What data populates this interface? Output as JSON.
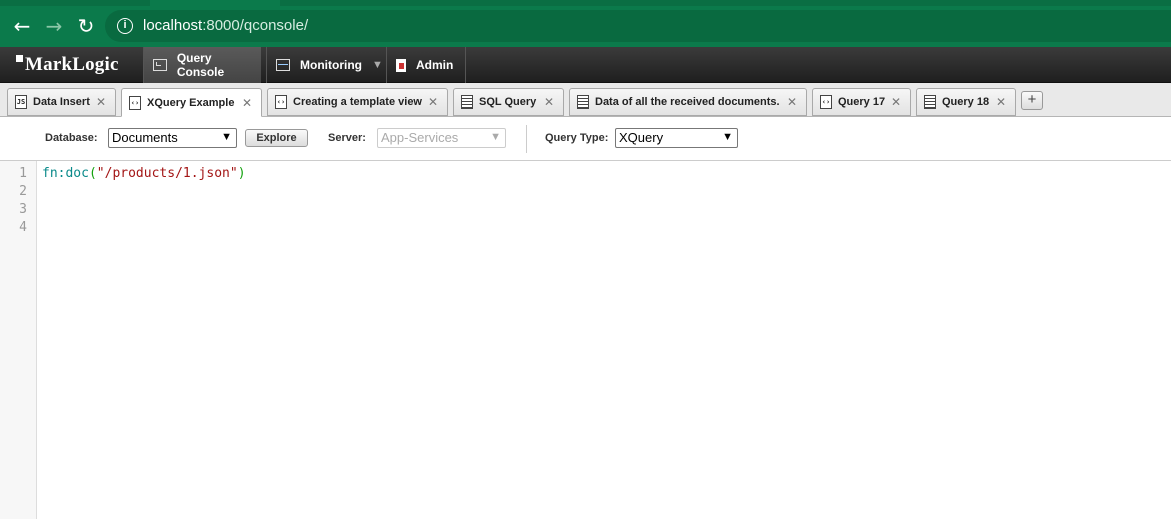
{
  "browser": {
    "url_host": "localhost",
    "url_path": ":8000/qconsole/"
  },
  "app": {
    "logo": "MarkLogic",
    "nav": [
      {
        "label": "Query Console"
      },
      {
        "label": "Monitoring"
      },
      {
        "label": "Admin"
      }
    ]
  },
  "tabs": [
    {
      "label": "Data Insert",
      "icon": "js-icon"
    },
    {
      "label": "XQuery Example",
      "icon": "xquery-icon",
      "active": true
    },
    {
      "label": "Creating a template view",
      "icon": "xquery-icon"
    },
    {
      "label": "SQL Query",
      "icon": "table-icon"
    },
    {
      "label": "Data of all the received documents.",
      "icon": "table-icon"
    },
    {
      "label": "Query 17",
      "icon": "xquery-icon"
    },
    {
      "label": "Query 18",
      "icon": "table-icon"
    }
  ],
  "toolbar": {
    "database_label": "Database:",
    "database_value": "Documents",
    "explore_label": "Explore",
    "server_label": "Server:",
    "server_value": "App-Services",
    "query_type_label": "Query Type:",
    "query_type_value": "XQuery"
  },
  "editor": {
    "line_numbers": [
      "1",
      "2",
      "3",
      "4"
    ],
    "code": {
      "fn": "fn:doc",
      "open": "(",
      "str": "\"/products/1.json\"",
      "close": ")"
    }
  }
}
